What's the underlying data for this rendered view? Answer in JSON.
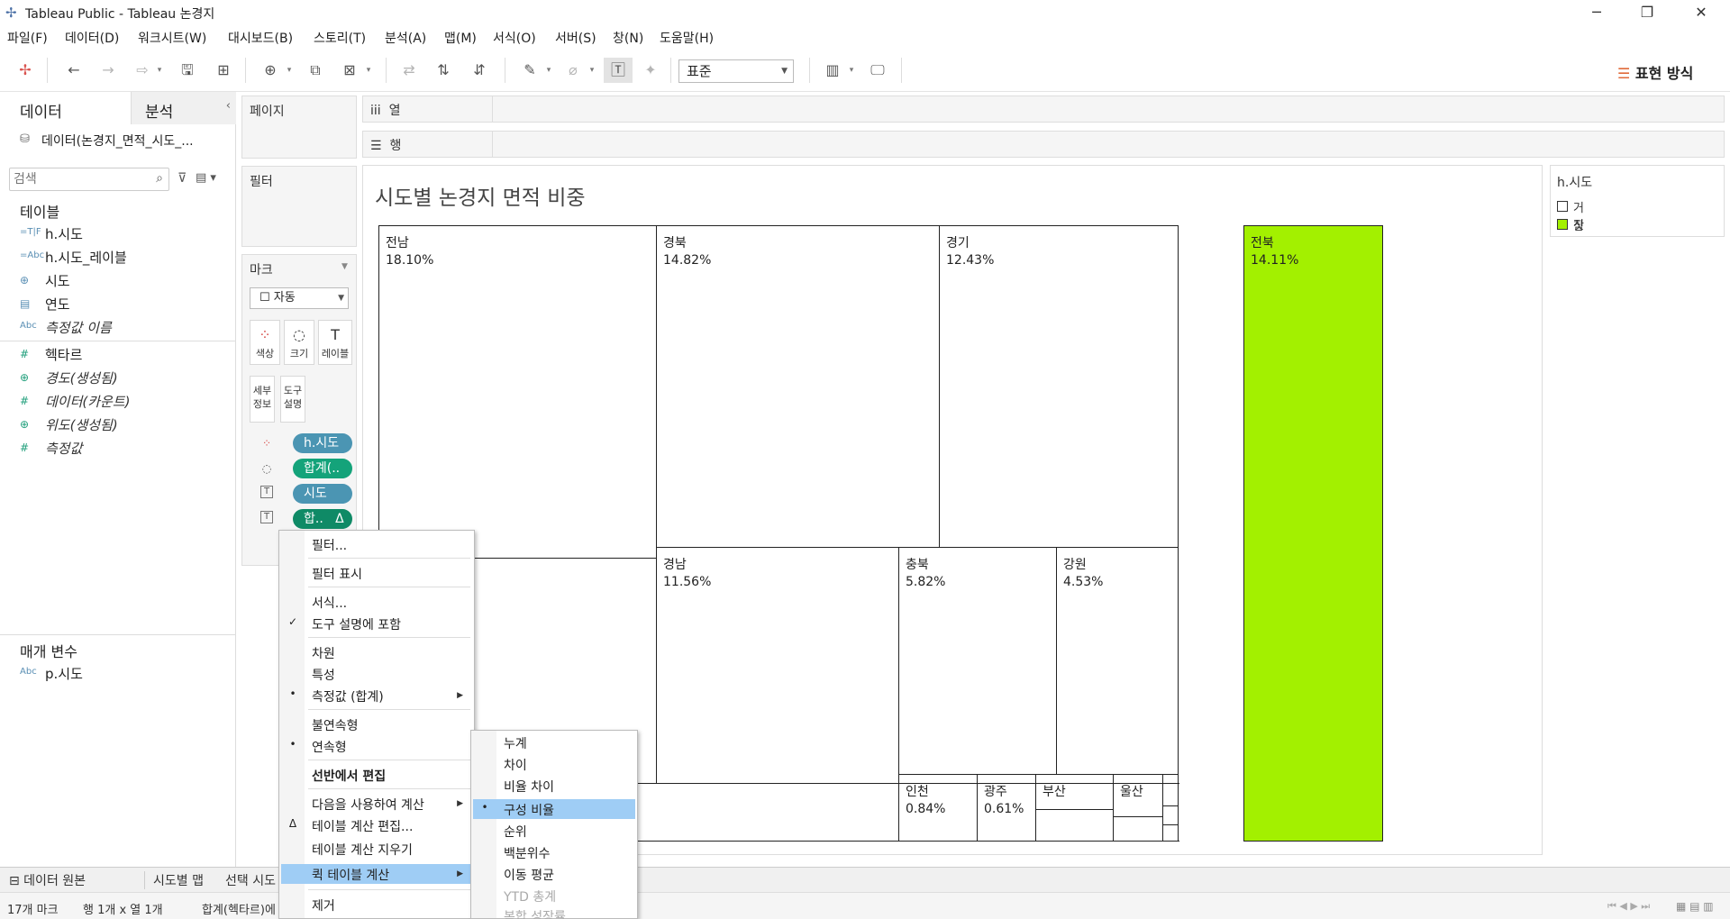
{
  "window": {
    "title": "Tableau Public - Tableau 논경지"
  },
  "menu": [
    "파일(F)",
    "데이터(D)",
    "워크시트(W)",
    "대시보드(B)",
    "스토리(T)",
    "분석(A)",
    "맵(M)",
    "서식(O)",
    "서버(S)",
    "창(N)",
    "도움말(H)"
  ],
  "toolbar": {
    "fit_select": "표준",
    "show_me": "표현 방식"
  },
  "left_panel": {
    "tab_data": "데이터",
    "tab_analysis": "분석",
    "collapse": "‹",
    "datasource": "데이터(논경지_면적_시도_...",
    "search_placeholder": "검색",
    "tables_title": "테이블",
    "fields": [
      {
        "icon": "=T|F",
        "name": "h.시도",
        "italic": false
      },
      {
        "icon": "=Abc",
        "name": "h.시도_레이블",
        "italic": false
      },
      {
        "icon": "⊕",
        "name": "시도",
        "italic": false
      },
      {
        "icon": "▤",
        "name": "연도",
        "italic": false
      },
      {
        "icon": "Abc",
        "name": "측정값 이름",
        "italic": true
      },
      {
        "icon": "#",
        "name": "헥타르",
        "italic": false
      },
      {
        "icon": "⊕",
        "name": "경도(생성됨)",
        "italic": true
      },
      {
        "icon": "#",
        "name": "데이터(카운트)",
        "italic": true
      },
      {
        "icon": "⊕",
        "name": "위도(생성됨)",
        "italic": true
      },
      {
        "icon": "#",
        "name": "측정값",
        "italic": true
      }
    ],
    "params_title": "매개 변수",
    "params": [
      {
        "icon": "Abc",
        "name": "p.시도"
      }
    ]
  },
  "shelves": {
    "pages": "페이지",
    "filters": "필터",
    "marks": "마크",
    "mark_type": "☐ 자동",
    "columns": "iii  열",
    "rows": "☰  행",
    "mark_buttons": [
      {
        "icon": "⁘",
        "label": "색상"
      },
      {
        "icon": "◌",
        "label": "크기"
      },
      {
        "icon": "T",
        "label": "레이블"
      }
    ],
    "detail": "세부\n정보",
    "tooltip": "도구\n설명",
    "pills": [
      {
        "icon": "⁘",
        "label": "h.시도",
        "color": "blue"
      },
      {
        "icon": "◌",
        "label": "합계(..",
        "color": "green"
      },
      {
        "icon": "T",
        "label": "시도",
        "color": "blue"
      },
      {
        "icon": "T",
        "label": "합..   Δ",
        "color": "dkgreen"
      }
    ]
  },
  "viz": {
    "title": "시도별 논경지 면적 비중",
    "cells": [
      {
        "name": "전남",
        "pct": "18.10%",
        "highlight": false
      },
      {
        "name": "경북",
        "pct": "14.82%",
        "highlight": false
      },
      {
        "name": "경기",
        "pct": "12.43%",
        "highlight": false
      },
      {
        "name": "전북",
        "pct": "14.11%",
        "highlight": true
      },
      {
        "name": "경남",
        "pct": "11.56%",
        "highlight": false
      },
      {
        "name": "충북",
        "pct": "5.82%",
        "highlight": false
      },
      {
        "name": "강원",
        "pct": "4.53%",
        "highlight": false
      },
      {
        "name": "인천",
        "pct": "0.84%",
        "highlight": false
      },
      {
        "name": "광주",
        "pct": "0.61%",
        "highlight": false
      },
      {
        "name": "부산",
        "pct": "",
        "highlight": false
      },
      {
        "name": "울산",
        "pct": "",
        "highlight": false
      }
    ],
    "highlight_color": "#a3f000"
  },
  "legend": {
    "title": "h.시도",
    "items": [
      {
        "label": "거짓",
        "color": "#ffffff"
      },
      {
        "label": "참",
        "color": "#a3f000"
      }
    ]
  },
  "context_menu": {
    "items": [
      {
        "label": "필터...",
        "mark": "",
        "sub": false,
        "bold": false
      },
      {
        "label": "필터 표시",
        "mark": "",
        "sub": false,
        "bold": false
      },
      {
        "label": "서식...",
        "mark": "",
        "sub": false,
        "bold": false
      },
      {
        "label": "도구 설명에 포함",
        "mark": "✓",
        "sub": false,
        "bold": false
      },
      {
        "label": "차원",
        "mark": "",
        "sub": false,
        "bold": false
      },
      {
        "label": "특성",
        "mark": "",
        "sub": false,
        "bold": false
      },
      {
        "label": "측정값 (합계)",
        "mark": "•",
        "sub": true,
        "bold": false
      },
      {
        "label": "불연속형",
        "mark": "",
        "sub": false,
        "bold": false
      },
      {
        "label": "연속형",
        "mark": "•",
        "sub": false,
        "bold": false
      },
      {
        "label": "선반에서 편집",
        "mark": "",
        "sub": false,
        "bold": true
      },
      {
        "label": "다음을 사용하여 계산",
        "mark": "",
        "sub": true,
        "bold": false
      },
      {
        "label": "테이블 계산 편집...",
        "mark": "Δ",
        "sub": false,
        "bold": false
      },
      {
        "label": "테이블 계산 지우기",
        "mark": "",
        "sub": false,
        "bold": false
      },
      {
        "label": "퀵 테이블 계산",
        "mark": "",
        "sub": true,
        "bold": false
      },
      {
        "label": "제거",
        "mark": "",
        "sub": false,
        "bold": false
      }
    ]
  },
  "submenu": {
    "items": [
      {
        "label": "누계",
        "mark": "",
        "dim": false
      },
      {
        "label": "차이",
        "mark": "",
        "dim": false
      },
      {
        "label": "비율 차이",
        "mark": "",
        "dim": false
      },
      {
        "label": "구성 비율",
        "mark": "•",
        "dim": false
      },
      {
        "label": "순위",
        "mark": "",
        "dim": false
      },
      {
        "label": "백분위수",
        "mark": "",
        "dim": false
      },
      {
        "label": "이동 평균",
        "mark": "",
        "dim": false
      },
      {
        "label": "YTD 총계",
        "mark": "",
        "dim": true
      },
      {
        "label": "복합 성장률",
        "mark": "",
        "dim": true
      }
    ]
  },
  "bottom_tabs": [
    "⊟ 데이터 원본",
    "시도별 맵",
    "선택 시도"
  ],
  "status": {
    "marks": "17개 마크",
    "rows_cols": "행 1개 x 열 1개",
    "sum": "합계(헥타르)에"
  }
}
